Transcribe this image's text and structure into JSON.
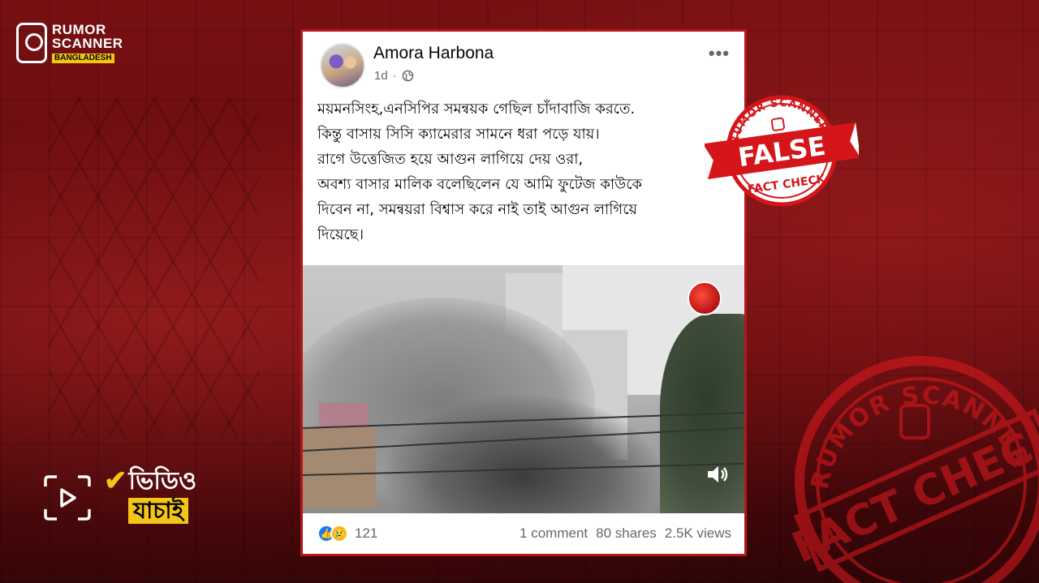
{
  "brand": {
    "line1": "RUMOR",
    "line2": "SCANNER",
    "line3": "BANGLADESH"
  },
  "video_badge": {
    "line1": "ভিডিও",
    "line2": "যাচাই"
  },
  "post": {
    "author": "Amora Harbona",
    "time": "1d",
    "more": "•••",
    "text_lines": [
      "ময়মনসিংহ,এনসিপির সমন্বয়ক গেছিল চাঁদাবাজি করতে.",
      "কিন্তু বাসায় সিসি ক্যামেরার সামনে ধরা পড়ে যায়।",
      "রাগে উত্তেজিত হয়ে আগুন লাগিয়ে দেয় ওরা,",
      "অবশ্য বাসার মালিক বলেছিলেন যে আমি ফুটেজ কাউকে",
      "দিবেন না, সমন্বয়রা বিশ্বাস করে নাই তাই আগুন লাগিয়ে",
      "দিয়েছে।"
    ],
    "reactions_count": "121",
    "comments": "1 comment",
    "shares": "80 shares",
    "views": "2.5K views"
  },
  "stamp_small": {
    "top_text": "RUMOR SCANNER",
    "label": "FALSE",
    "bottom_text": "FACT CHECK"
  },
  "stamp_big": {
    "top_text": "RUMOR SCANNER",
    "label": "FACT CHECK"
  },
  "colors": {
    "brand_red": "#b4171b",
    "accent_yellow": "#f4c516",
    "fb_blue": "#1877f2"
  }
}
